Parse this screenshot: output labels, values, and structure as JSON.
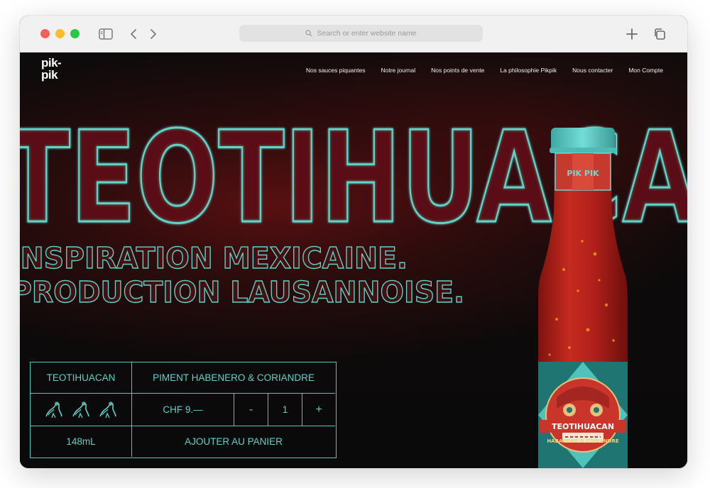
{
  "browser": {
    "address_placeholder": "Search or enter website name"
  },
  "site": {
    "logo_line1": "pik-",
    "logo_line2": "pik",
    "nav": [
      "Nos sauces piquantes",
      "Notre journal",
      "Nos points de vente",
      "La philosophie Pikpik",
      "Nous contacter",
      "Mon Compte"
    ],
    "hero": {
      "title": "TEOTIHUACAN",
      "line1": "INSPIRATION MEXICAINE.",
      "line2": "PRODUCTION LAUSANNOISE."
    },
    "bottle": {
      "brand": "PIK PIK",
      "label_name": "TEOTIHUACAN",
      "label_sub": "HABANERO & CORIANDRE"
    },
    "product": {
      "name": "TEOTIHUACAN",
      "flavor": "PIMENT HABENERO & CORIANDRE",
      "heat_level": 3,
      "heat_max": 3,
      "price": "CHF 9.—",
      "minus": "-",
      "quantity": "1",
      "plus": "+",
      "volume": "148mL",
      "add_to_cart": "AJOUTER AU PANIER"
    }
  },
  "colors": {
    "accent": "#5ed0c7",
    "title_red": "#6b1416",
    "bottle_red": "#b3211b",
    "cap": "#5fc9c4"
  }
}
